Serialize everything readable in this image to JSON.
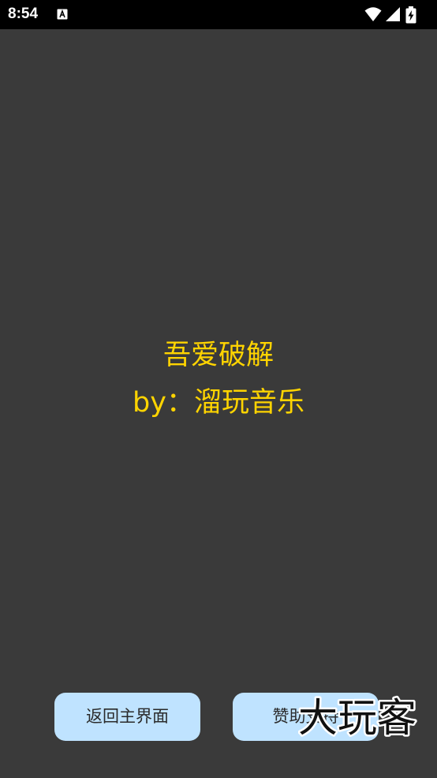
{
  "status_bar": {
    "time": "8:54",
    "icons": [
      "accessibility-a-icon",
      "wifi-icon",
      "signal-icon",
      "battery-charging-icon"
    ]
  },
  "main": {
    "title": "吾爱破解",
    "author": "by：溜玩音乐"
  },
  "buttons": {
    "back_label": "返回主界面",
    "support_label": "赞助支持"
  },
  "watermark": {
    "text": "大玩客"
  },
  "colors": {
    "background": "#3a3a3a",
    "status_bar": "#000000",
    "text_accent": "#ffd400",
    "button_bg": "#bfe3ff"
  }
}
